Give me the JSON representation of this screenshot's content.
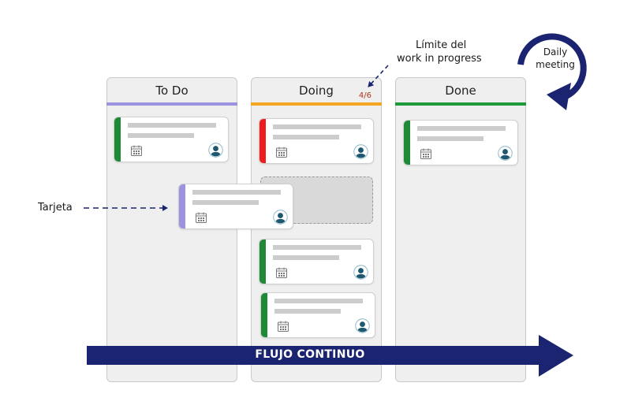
{
  "colors": {
    "navy": "#1b2471",
    "todo_bar": "#9b93e0",
    "doing_bar": "#f5a623",
    "done_bar": "#1e9a3a",
    "card_green": "#1e8a36",
    "card_red": "#ee1c1c",
    "card_purple": "#9b93e0",
    "wip_text": "#b0331a",
    "avatar": "#1e5770"
  },
  "columns": [
    {
      "title": "To Do"
    },
    {
      "title": "Doing",
      "wip_limit": "4/6"
    },
    {
      "title": "Done"
    }
  ],
  "annotations": {
    "wip_line1": "Límite del",
    "wip_line2": "work in progress",
    "card": "Tarjeta",
    "daily_line1": "Daily",
    "daily_line2": "meeting",
    "flow": "FLUJO CONTINUO"
  },
  "cards": [
    {
      "column": "To Do",
      "status_color": "green",
      "icons": [
        "calendar-icon",
        "avatar-icon"
      ]
    },
    {
      "column": "To Do",
      "status_color": "purple",
      "state": "being dragged",
      "icons": [
        "calendar-icon",
        "avatar-icon"
      ]
    },
    {
      "column": "Doing",
      "status_color": "red",
      "icons": [
        "calendar-icon",
        "avatar-icon"
      ]
    },
    {
      "column": "Doing",
      "status_color": "green",
      "icons": [
        "calendar-icon",
        "avatar-icon"
      ]
    },
    {
      "column": "Doing",
      "status_color": "green",
      "icons": [
        "calendar-icon",
        "avatar-icon"
      ]
    },
    {
      "column": "Done",
      "status_color": "green",
      "icons": [
        "calendar-icon",
        "avatar-icon"
      ]
    }
  ],
  "drop_placeholder": {
    "column": "Doing"
  }
}
